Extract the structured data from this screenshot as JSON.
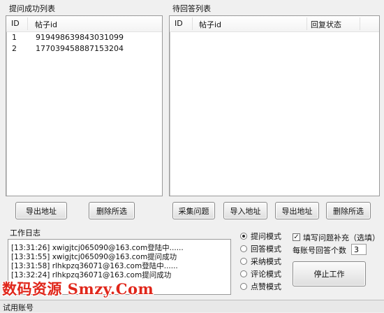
{
  "left_panel": {
    "title": "提问成功列表",
    "columns": [
      "ID",
      "帖子id"
    ],
    "rows": [
      {
        "id": "1",
        "post_id": "919498639843031099"
      },
      {
        "id": "2",
        "post_id": "177039458887153204"
      }
    ],
    "buttons": {
      "export": "导出地址",
      "delete": "删除所选"
    }
  },
  "right_panel": {
    "title": "待回答列表",
    "columns": [
      "ID",
      "帖子id",
      "回复状态"
    ],
    "rows": [],
    "buttons": {
      "collect": "采集问题",
      "import": "导入地址",
      "export": "导出地址",
      "delete": "删除所选"
    }
  },
  "log": {
    "title": "工作日志",
    "lines": [
      "[13:31:26] xwigjtcj065090@163.com登陆中......",
      "[13:31:55] xwigjtcj065090@163.com提问成功",
      "[13:31:58] rlhkpzq36071@163.com登陆中......",
      "[13:32:24] rlhkpzq36071@163.com提问成功"
    ]
  },
  "modes": {
    "options": [
      "提问模式",
      "回答模式",
      "采纳模式",
      "评论模式",
      "点赞模式"
    ],
    "selected_index": 0
  },
  "settings": {
    "fill_supplement_label": "填写问题补充（选填）",
    "fill_supplement_checked": true,
    "answers_per_account_label": "每账号回答个数",
    "answers_per_account_value": "3"
  },
  "stop_button": "停止工作",
  "watermark": "数码资源 Smzy.Com",
  "status_bar": {
    "text": "试用账号"
  }
}
